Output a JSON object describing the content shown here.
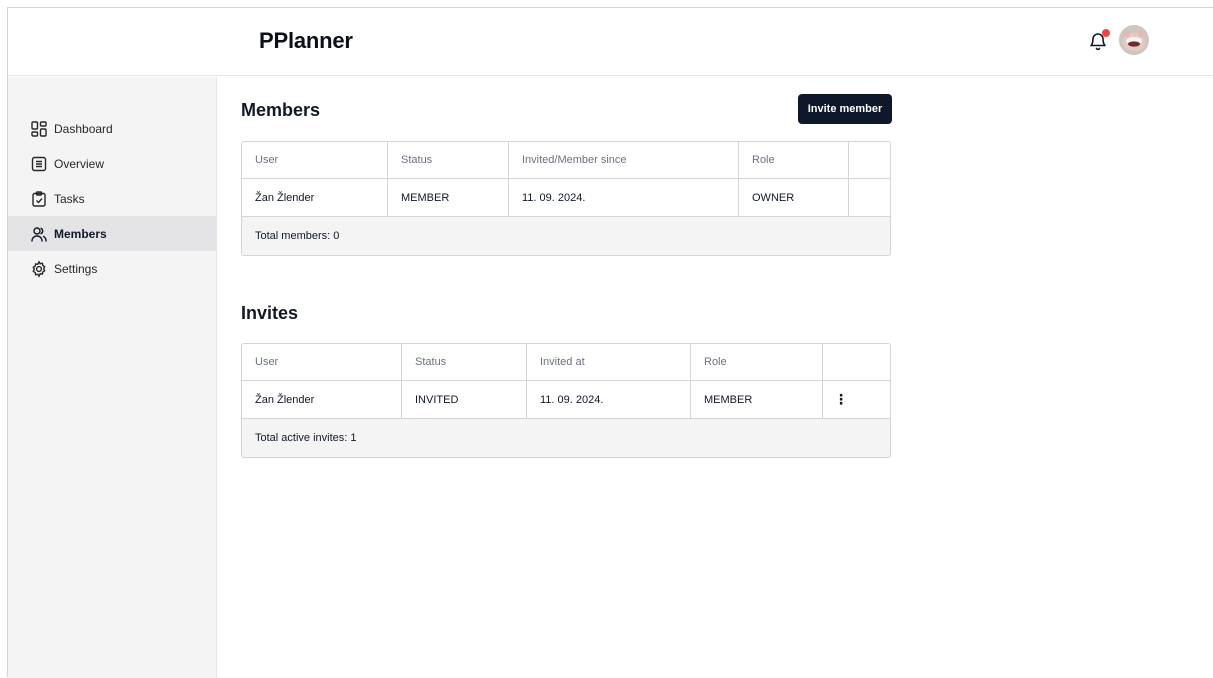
{
  "app": {
    "title": "PPlanner"
  },
  "header": {
    "notification_icon": "bell-icon",
    "avatar": "user-avatar"
  },
  "colors": {
    "accent": "#0f172a",
    "notification": "#ef4444",
    "sidebar_bg": "#f4f4f5",
    "sidebar_active": "#e4e4e7"
  },
  "sidebar": {
    "items": [
      {
        "label": "Dashboard",
        "icon": "dashboard-icon"
      },
      {
        "label": "Overview",
        "icon": "overview-icon"
      },
      {
        "label": "Tasks",
        "icon": "tasks-icon"
      },
      {
        "label": "Members",
        "icon": "members-icon",
        "active": true
      },
      {
        "label": "Settings",
        "icon": "settings-icon"
      }
    ]
  },
  "members": {
    "title": "Members",
    "invite_button": "Invite member",
    "columns": [
      "User",
      "Status",
      "Invited/Member since",
      "Role",
      ""
    ],
    "rows": [
      {
        "user": "Žan Žlender",
        "status": "MEMBER",
        "since": "11. 09. 2024.",
        "role": "OWNER"
      }
    ],
    "footer": "Total members: 0"
  },
  "invites": {
    "title": "Invites",
    "columns": [
      "User",
      "Status",
      "Invited at",
      "Role",
      ""
    ],
    "rows": [
      {
        "user": "Žan Žlender",
        "status": "INVITED",
        "invited_at": "11. 09. 2024.",
        "role": "MEMBER",
        "actions": "⋮"
      }
    ],
    "footer": "Total active invites: 1"
  }
}
